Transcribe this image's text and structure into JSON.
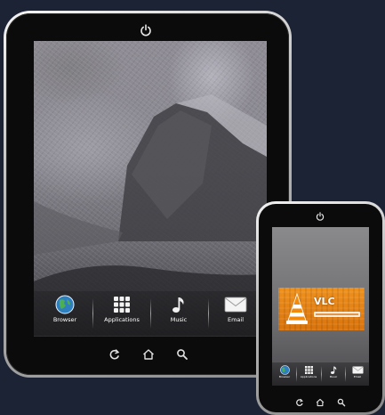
{
  "tablet": {
    "dock": [
      {
        "label": "Browser",
        "icon": "globe-icon"
      },
      {
        "label": "Applications",
        "icon": "app-grid-icon"
      },
      {
        "label": "Music",
        "icon": "music-note-icon"
      },
      {
        "label": "Email",
        "icon": "envelope-icon"
      }
    ],
    "navbar": [
      "back-icon",
      "home-icon",
      "search-icon"
    ],
    "power_icon": "power-icon"
  },
  "phone": {
    "banner": {
      "logo_icon": "vlc-cone-icon",
      "title": "VLC"
    },
    "dock": [
      {
        "label": "Browser",
        "icon": "globe-icon"
      },
      {
        "label": "Applications",
        "icon": "app-grid-icon"
      },
      {
        "label": "Music",
        "icon": "music-note-icon"
      },
      {
        "label": "Email",
        "icon": "envelope-icon"
      }
    ],
    "navbar": [
      "back-icon",
      "home-icon",
      "search-icon"
    ],
    "power_icon": "power-icon"
  },
  "colors": {
    "background": "#1c2335",
    "bezel": "#0b0b0c",
    "vlc_orange": "#e8830f"
  }
}
